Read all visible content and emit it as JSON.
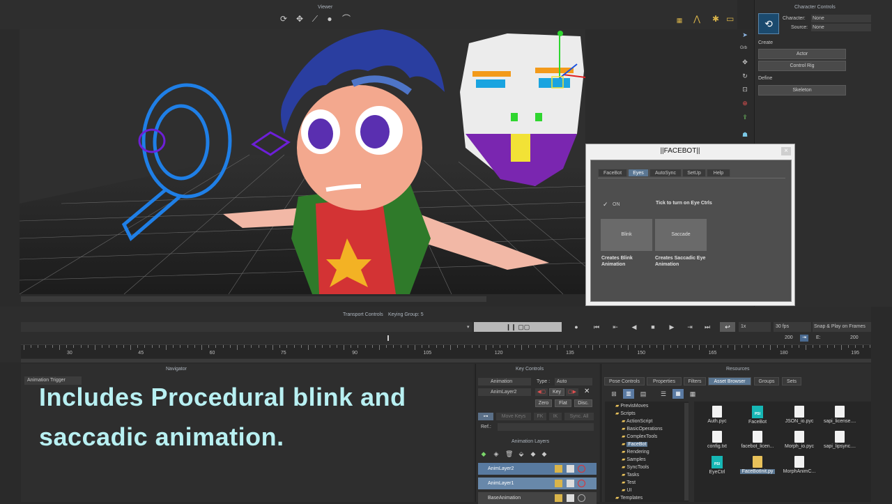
{
  "viewer": {
    "title": "Viewer"
  },
  "character_controls": {
    "title": "Character Controls",
    "character_label": "Character:",
    "character_value": "None",
    "source_label": "Source:",
    "source_value": "None",
    "create_label": "Create",
    "actor_button": "Actor",
    "control_rig_button": "Control Rig",
    "define_label": "Define",
    "skeleton_button": "Skeleton",
    "side_tool_label": "Grb"
  },
  "facebot": {
    "title": "||FACEBOT||",
    "close": "×",
    "tabs": [
      "FaceBot",
      "Eyes",
      "AutoSync",
      "SetUp",
      "Help"
    ],
    "active_tab": "Eyes",
    "checkbox_label": "ON",
    "checkbox_checked": true,
    "hint": "Tick to turn on Eye Ctrls",
    "blink_button": "Blink",
    "saccade_button": "Saccade",
    "blink_desc": "Creates Blink Animation",
    "saccade_desc": "Creates Saccadic Eye Animation"
  },
  "transport": {
    "title": "Transport Controls",
    "keying_group": "Keying Group: 5",
    "speed": "1x",
    "fps": "30 fps",
    "snap": "Snap & Play on Frames",
    "frame_end": "200",
    "frame_label": "E:",
    "frame_value": "200",
    "ruler_ticks": [
      "30",
      "45",
      "60",
      "75",
      "90",
      "105",
      "120",
      "135",
      "150",
      "165",
      "180",
      "195"
    ]
  },
  "navigator": {
    "title": "Navigator",
    "item": "Animation Trigger"
  },
  "overlay": {
    "line1": "Includes Procedural blink and",
    "line2": "saccadic animation."
  },
  "key_controls": {
    "title": "Key Controls",
    "animation_label": "Animation",
    "type_label": "Type :",
    "type_value": "Auto",
    "layer_value": "AnimLayer2",
    "key_button": "Key",
    "zero_button": "Zero",
    "flat_button": "Flat",
    "disc_button": "Disc.",
    "move_keys": "Move Keys",
    "fk": "FK",
    "ik": "IK",
    "sync_all": "Sync. All",
    "ref_label": "Ref.:"
  },
  "animation_layers": {
    "title": "Animation Layers",
    "layers": [
      "AnimLayer2",
      "AnimLayer1",
      "BaseAnimation"
    ]
  },
  "resources": {
    "title": "Resources",
    "tabs": [
      "Pose Controls",
      "Properties",
      "Filters",
      "Asset Browser",
      "Groups",
      "Sets"
    ],
    "active_tab": "Asset Browser",
    "tree": [
      "PrevisMoves",
      "Scripts",
      "ActionScript",
      "BasicOperations",
      "ComplexTools",
      "FaceBot",
      "Rendering",
      "Samples",
      "SyncTools",
      "Tasks",
      "Test",
      "UI",
      "Templates"
    ],
    "files": [
      "Auth.pyc",
      "FaceBot",
      "JSON_io.pyc",
      "sapi_license....",
      "config.txt",
      "facebot_licen...",
      "Morph_io.pyc",
      "sapi_lipsync....",
      "EyeCtrl",
      "FaceBotInit.py",
      "MorphAnimC..."
    ]
  },
  "colors": {
    "accent": "#5b7793",
    "overlay_text": "#b8f0f2",
    "rig_blue": "#1a7de0",
    "rig_purple": "#6a1ad8"
  }
}
